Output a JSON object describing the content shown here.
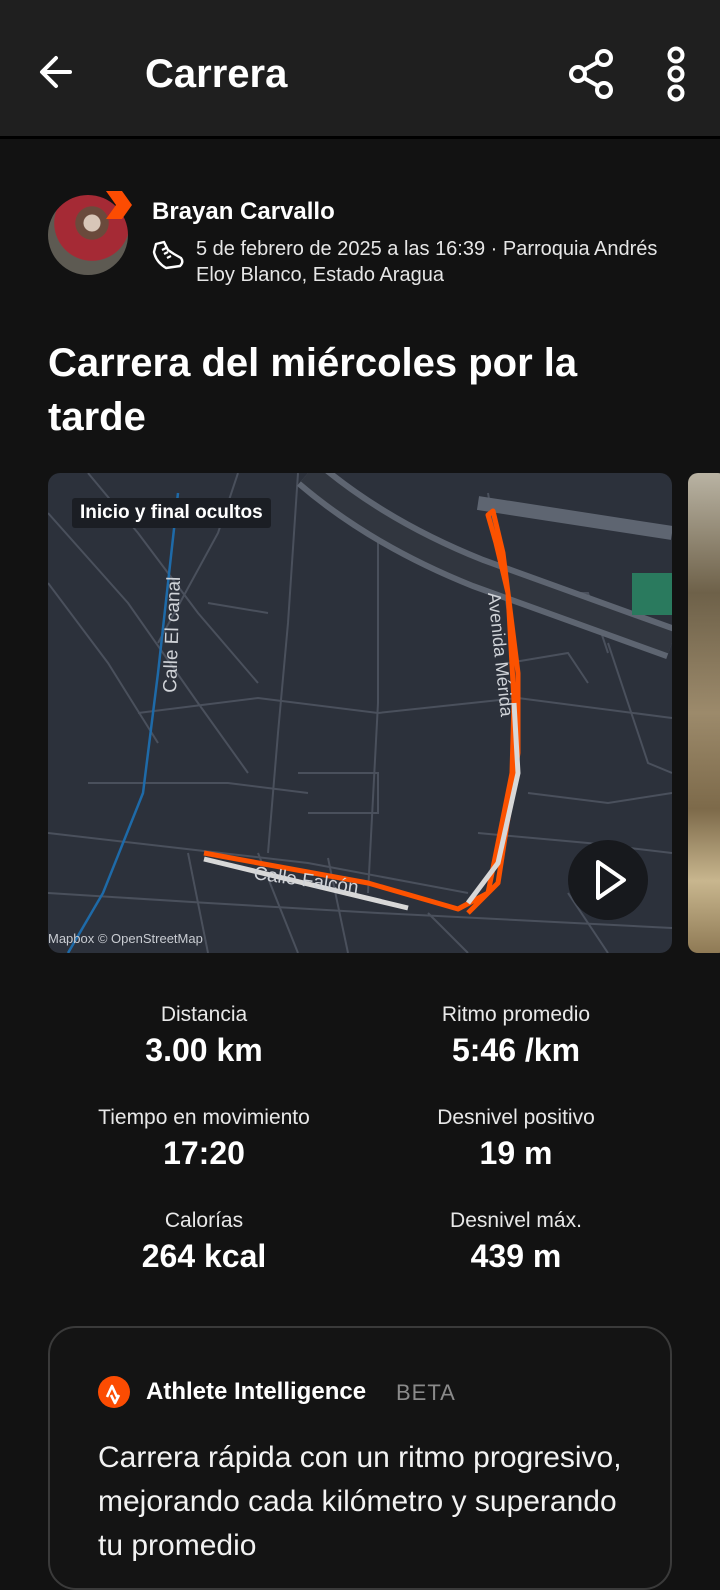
{
  "header": {
    "title": "Carrera",
    "back_icon": "arrow-left-icon",
    "share_icon": "share-icon",
    "more_icon": "more-vertical-icon"
  },
  "athlete": {
    "name": "Brayan Carvallo",
    "meta": "5 de febrero de 2025 a las 16:39 · Parroquia Andrés Eloy Blanco, Estado Aragua",
    "activity_icon": "running-shoe-icon",
    "badge_color": "#fc4c02"
  },
  "activity": {
    "title": "Carrera del miércoles por la tarde"
  },
  "map": {
    "hidden_label": "Inicio y final ocultos",
    "attribution": "Mapbox © OpenStreetMap",
    "streets": [
      "Calle El canal",
      "Avenida Mérida",
      "Calle Falcón"
    ],
    "route_color": "#fc5200",
    "play_icon": "play-icon"
  },
  "stats": [
    {
      "label": "Distancia",
      "value": "3.00 km"
    },
    {
      "label": "Ritmo promedio",
      "value": "5:46 /km"
    },
    {
      "label": "Tiempo en movimiento",
      "value": "17:20"
    },
    {
      "label": "Desnivel positivo",
      "value": "19 m"
    },
    {
      "label": "Calorías",
      "value": "264 kcal"
    },
    {
      "label": "Desnivel máx.",
      "value": "439 m"
    }
  ],
  "athlete_intelligence": {
    "title": "Athlete Intelligence",
    "beta": "BETA",
    "text": "Carrera rápida con un ritmo progresivo, mejorando cada kilómetro y superando tu promedio",
    "logo_color": "#fc4c02"
  }
}
